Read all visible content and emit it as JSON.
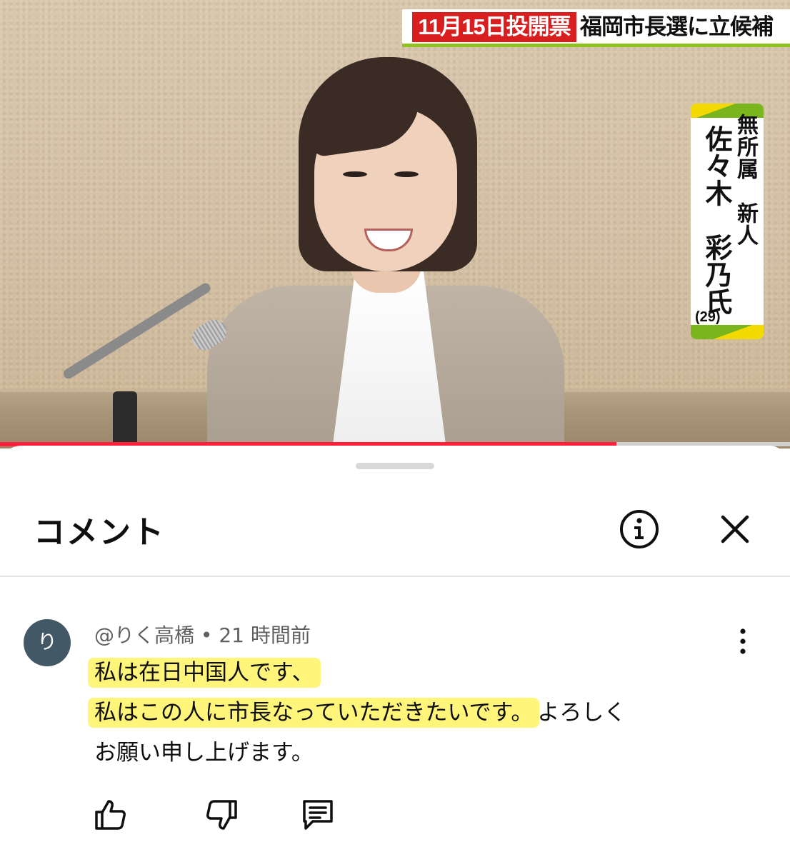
{
  "video": {
    "caption_date": "11月15日投開票",
    "caption_title": "福岡市長選に立候補",
    "name_card": {
      "party": "無所属　新人",
      "name": "佐々木　彩乃氏",
      "age": "(29)"
    },
    "progress": 0.78,
    "colors": {
      "caption_red": "#d81e1e",
      "caption_green": "#8dc21f",
      "progress": "#ff1f3a"
    }
  },
  "sheet": {
    "title": "コメント",
    "info_icon": "info-circle-icon",
    "close_icon": "close-icon"
  },
  "comment": {
    "avatar_letter": "り",
    "avatar_color": "#435866",
    "author": "@りく高橋",
    "separator": " • ",
    "time": "21 時間前",
    "line1": "私は在日中国人です、",
    "line2_highlighted": "私はこの人に市長なっていただきたいです。",
    "line2_rest": "よろしく",
    "line3": "お願い申し上げます。",
    "highlight_color": "#fff57a",
    "actions": [
      "thumbs-up-icon",
      "thumbs-down-icon",
      "reply-icon"
    ]
  }
}
